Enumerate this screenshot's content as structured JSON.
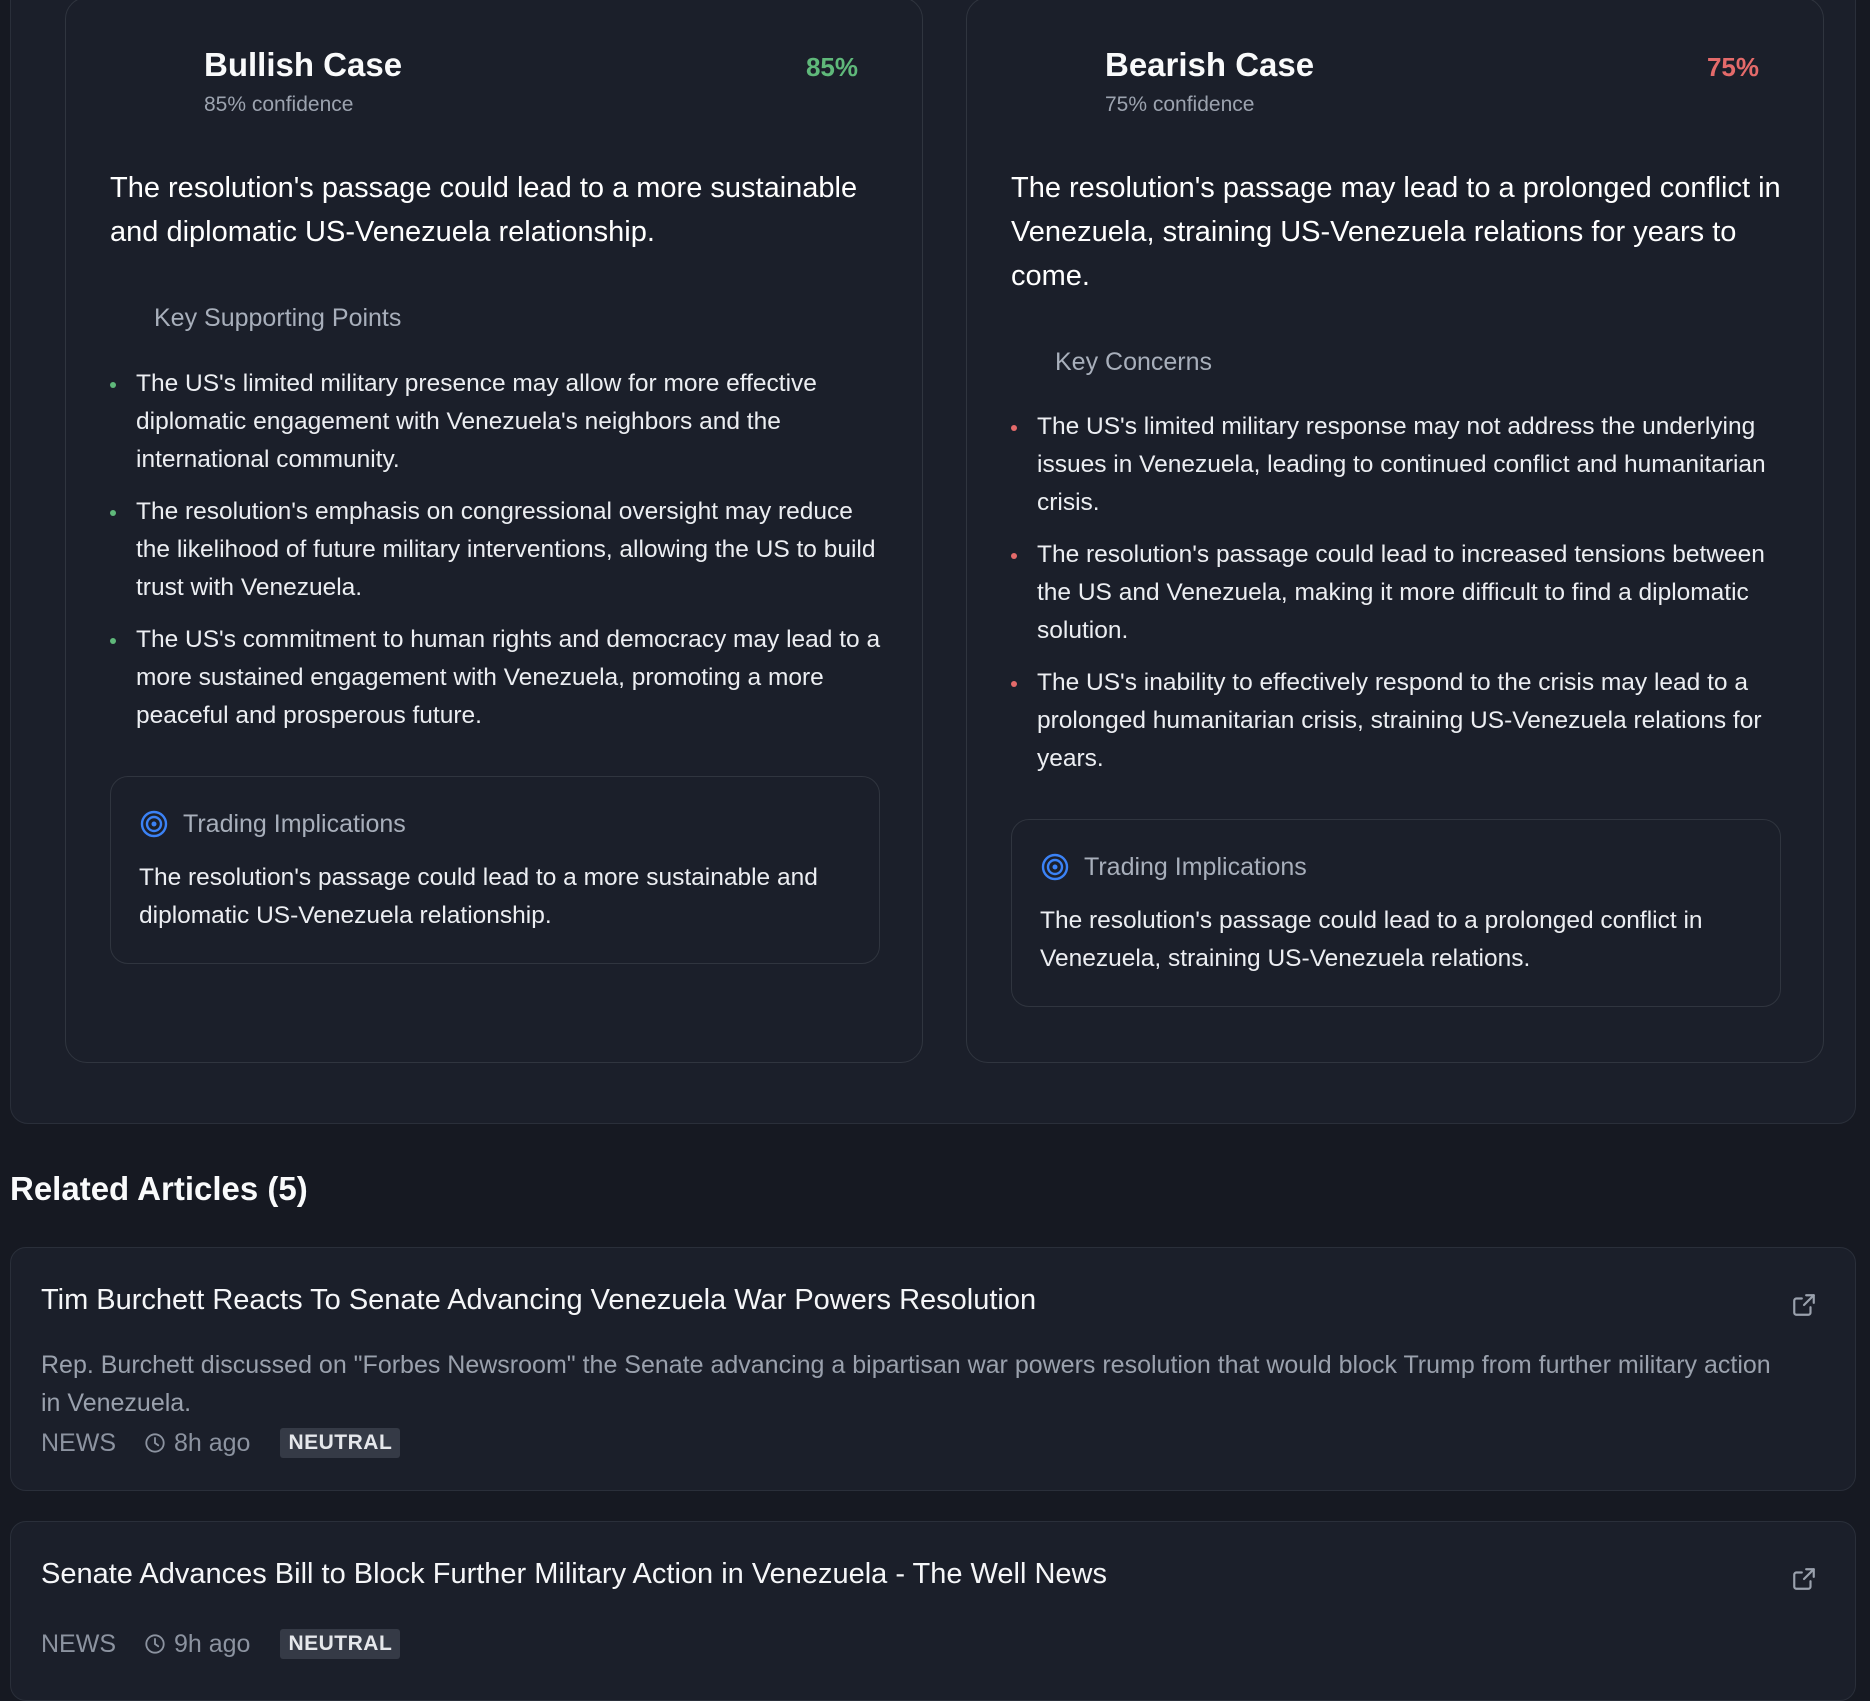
{
  "bullish": {
    "title": "Bullish Case",
    "confidence_label": "85% confidence",
    "confidence_pct": "85%",
    "thesis": "The resolution's passage could lead to a more sustainable and diplomatic US-Venezuela relationship.",
    "section_label": "Key Supporting Points",
    "points": [
      "The US's limited military presence may allow for more effective diplomatic engagement with Venezuela's neighbors and the international community.",
      "The resolution's emphasis on congressional oversight may reduce the likelihood of future military interventions, allowing the US to build trust with Venezuela.",
      "The US's commitment to human rights and democracy may lead to a more sustained engagement with Venezuela, promoting a more peaceful and prosperous future."
    ],
    "implications_title": "Trading Implications",
    "implications_text": "The resolution's passage could lead to a more sustainable and diplomatic US-Venezuela relationship.",
    "accent_color": "#5fb87a"
  },
  "bearish": {
    "title": "Bearish Case",
    "confidence_label": "75% confidence",
    "confidence_pct": "75%",
    "thesis": "The resolution's passage may lead to a prolonged conflict in Venezuela, straining US-Venezuela relations for years to come.",
    "section_label": "Key Concerns",
    "points": [
      "The US's limited military response may not address the underlying issues in Venezuela, leading to continued conflict and humanitarian crisis.",
      "The resolution's passage could lead to increased tensions between the US and Venezuela, making it more difficult to find a diplomatic solution.",
      "The US's inability to effectively respond to the crisis may lead to a prolonged humanitarian crisis, straining US-Venezuela relations for years."
    ],
    "implications_title": "Trading Implications",
    "implications_text": "The resolution's passage could lead to a prolonged conflict in Venezuela, straining US-Venezuela relations.",
    "accent_color": "#e46a6a"
  },
  "related": {
    "heading": "Related Articles (5)",
    "articles": [
      {
        "title": "Tim Burchett Reacts To Senate Advancing Venezuela War Powers Resolution",
        "description": "Rep. Burchett discussed on \"Forbes Newsroom\" the Senate advancing a bipartisan war powers resolution that would block Trump from further military action in Venezuela.",
        "source": "NEWS",
        "time": "8h ago",
        "sentiment": "NEUTRAL"
      },
      {
        "title": "Senate Advances Bill to Block Further Military Action in Venezuela - The Well News",
        "source": "NEWS",
        "time": "9h ago",
        "sentiment": "NEUTRAL"
      }
    ]
  },
  "icons": {
    "implications": "target-icon",
    "article_link": "external-link-icon",
    "time": "clock-icon"
  },
  "colors": {
    "background": "#161922",
    "card": "#1b1f2a",
    "accent_blue": "#3b82f6"
  }
}
